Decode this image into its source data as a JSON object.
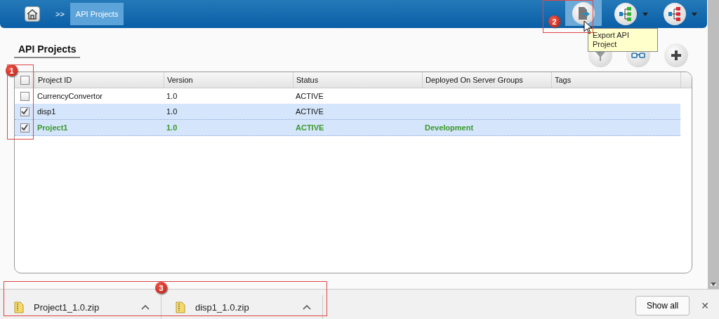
{
  "breadcrumb": {
    "separator": ">>",
    "items": [
      {
        "label": "API Projects",
        "selected": true
      }
    ]
  },
  "toolbar": {
    "tooltip": "Export API Project"
  },
  "page_title": "API Projects",
  "table": {
    "columns": [
      "Project ID",
      "Version",
      "Status",
      "Deployed On Server Groups",
      "Tags"
    ],
    "all_checked": false,
    "rows": [
      {
        "cells": [
          "CurrencyConvertor",
          "1.0",
          "ACTIVE",
          "",
          ""
        ],
        "checked": false,
        "selected": false,
        "current": false
      },
      {
        "cells": [
          "disp1",
          "1.0",
          "ACTIVE",
          "",
          ""
        ],
        "checked": true,
        "selected": true,
        "current": false
      },
      {
        "cells": [
          "Project1",
          "1.0",
          "ACTIVE",
          "Development",
          ""
        ],
        "checked": true,
        "selected": true,
        "current": true
      }
    ]
  },
  "annotations": [
    {
      "label": "1"
    },
    {
      "label": "2"
    },
    {
      "label": "3"
    }
  ],
  "downloads": {
    "items": [
      {
        "name": "Project1_1.0.zip"
      },
      {
        "name": "disp1_1.0.zip"
      }
    ],
    "show_all": "Show all",
    "close": "✕"
  }
}
